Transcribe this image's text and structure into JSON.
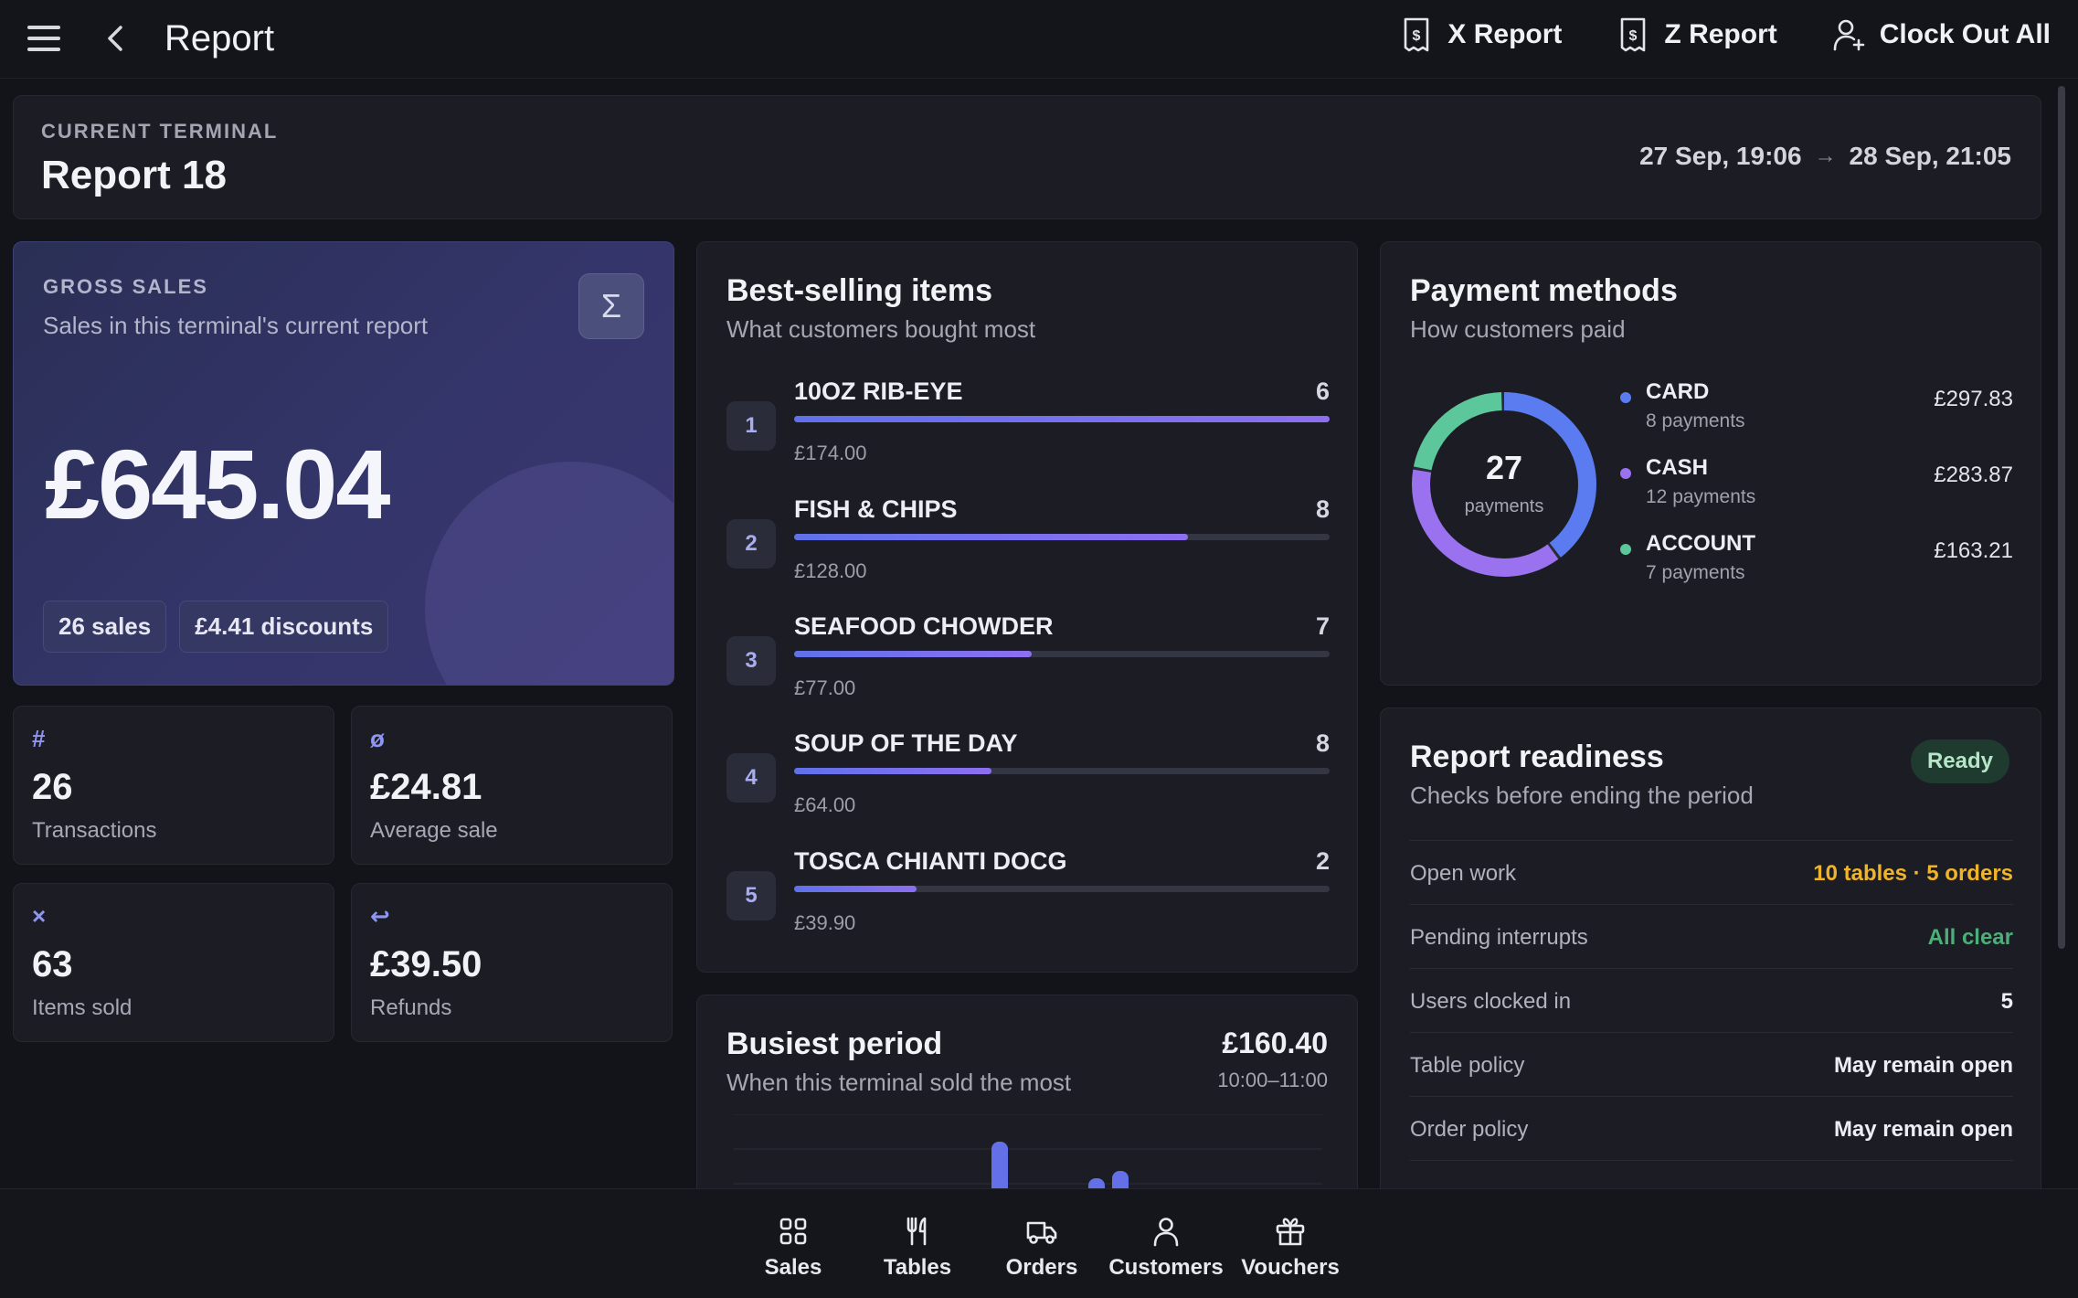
{
  "header": {
    "title": "Report",
    "actions": [
      {
        "label": "X Report",
        "icon": "receipt-icon"
      },
      {
        "label": "Z Report",
        "icon": "receipt-icon"
      },
      {
        "label": "Clock Out All",
        "icon": "user-plus-icon"
      }
    ]
  },
  "terminal": {
    "label": "CURRENT TERMINAL",
    "name": "Report 18",
    "start": "27 Sep, 19:06",
    "arrow": "→",
    "end": "28 Sep, 21:05"
  },
  "gross": {
    "label": "GROSS SALES",
    "subtitle": "Sales in this terminal's current report",
    "sigma": "Σ",
    "amount": "£645.04",
    "sales_pill": "26 sales",
    "discount_pill": "£4.41 discounts"
  },
  "stats": [
    {
      "icon": "#",
      "value": "26",
      "caption": "Transactions"
    },
    {
      "icon": "ø",
      "value": "£24.81",
      "caption": "Average sale"
    },
    {
      "icon": "×",
      "value": "63",
      "caption": "Items sold"
    },
    {
      "icon": "↩",
      "value": "£39.50",
      "caption": "Refunds"
    }
  ],
  "best_selling": {
    "title": "Best-selling items",
    "subtitle": "What customers bought most",
    "items": [
      {
        "rank": "1",
        "name": "10OZ RIB-EYE",
        "qty": "6",
        "revenue": "£174.00",
        "share": 1.0
      },
      {
        "rank": "2",
        "name": "FISH & CHIPS",
        "qty": "8",
        "revenue": "£128.00",
        "share": 0.735
      },
      {
        "rank": "3",
        "name": "SEAFOOD CHOWDER",
        "qty": "7",
        "revenue": "£77.00",
        "share": 0.443
      },
      {
        "rank": "4",
        "name": "SOUP OF THE DAY",
        "qty": "8",
        "revenue": "£64.00",
        "share": 0.368
      },
      {
        "rank": "5",
        "name": "TOSCA CHIANTI DOCG",
        "qty": "2",
        "revenue": "£39.90",
        "share": 0.229
      }
    ]
  },
  "busiest": {
    "title": "Busiest period",
    "subtitle": "When this terminal sold the most",
    "amount": "£160.40",
    "time": "10:00–11:00"
  },
  "payments": {
    "title": "Payment methods",
    "subtitle": "How customers paid",
    "total": "27",
    "total_label": "payments",
    "methods": [
      {
        "name": "CARD",
        "count": "8 payments",
        "amount": "£297.83",
        "value": 297.83,
        "color": "#5b7cf0"
      },
      {
        "name": "CASH",
        "count": "12 payments",
        "amount": "£283.87",
        "value": 283.87,
        "color": "#9a72f0"
      },
      {
        "name": "ACCOUNT",
        "count": "7 payments",
        "amount": "£163.21",
        "value": 163.21,
        "color": "#5cc79a"
      }
    ]
  },
  "readiness": {
    "title": "Report readiness",
    "subtitle": "Checks before ending the period",
    "badge": "Ready",
    "rows": [
      {
        "key": "Open work",
        "value": "10 tables · 5 orders",
        "color": "#f0b429"
      },
      {
        "key": "Pending interrupts",
        "value": "All clear",
        "color": "#4caf7a"
      },
      {
        "key": "Users clocked in",
        "value": "5",
        "color": "#eceef3"
      },
      {
        "key": "Table policy",
        "value": "May remain open",
        "color": "#eceef3"
      },
      {
        "key": "Order policy",
        "value": "May remain open",
        "color": "#eceef3"
      }
    ]
  },
  "nav": [
    {
      "label": "Sales",
      "icon": "grid-icon"
    },
    {
      "label": "Tables",
      "icon": "cutlery-icon"
    },
    {
      "label": "Orders",
      "icon": "truck-icon"
    },
    {
      "label": "Customers",
      "icon": "person-icon"
    },
    {
      "label": "Vouchers",
      "icon": "gift-icon"
    }
  ]
}
